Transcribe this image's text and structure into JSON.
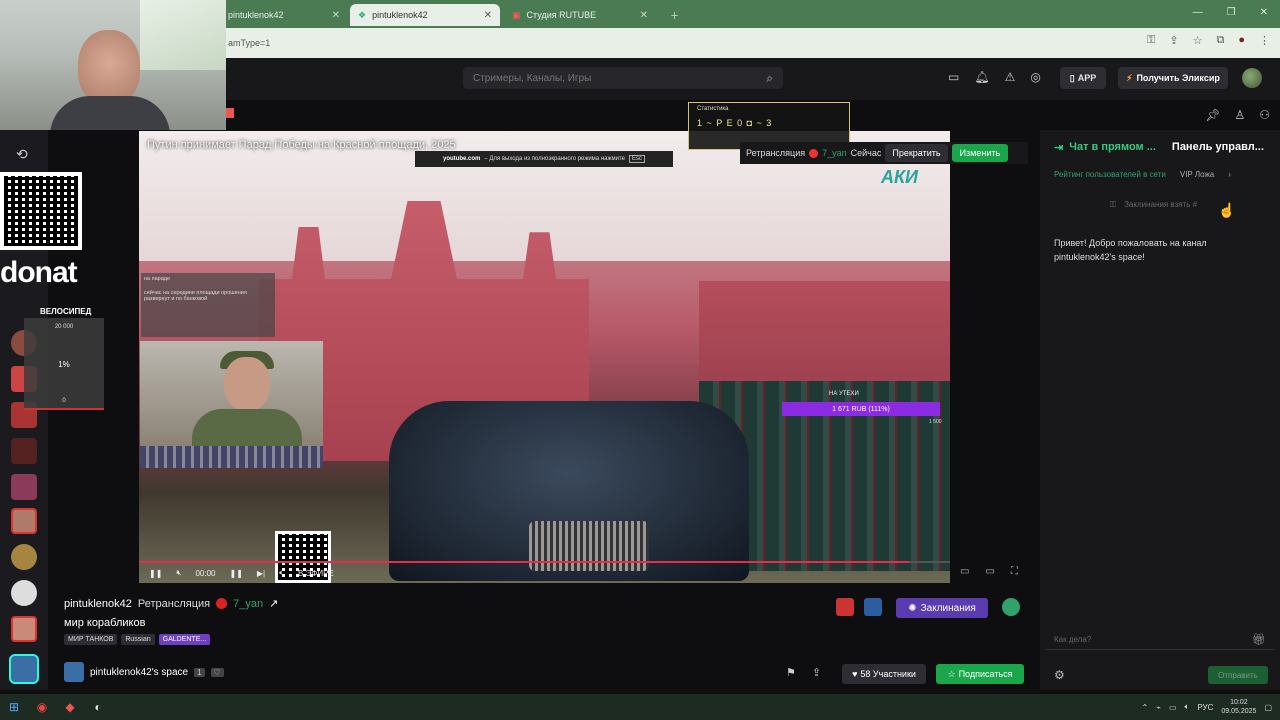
{
  "browser": {
    "tabs": [
      {
        "label": "pintuklenok42"
      },
      {
        "label": "pintuklenok42"
      },
      {
        "label": "Студия RUTUBE"
      }
    ],
    "address": "amType=1"
  },
  "header": {
    "search_placeholder": "Стримеры, Каналы, Игры",
    "app_label": "APP",
    "elixir_label": "Получить Эликсир"
  },
  "left_overlay": {
    "donat_text": "donat",
    "bike_label": "ВЕЛОСИПЕД",
    "goal_top": "20 000",
    "goal_percent": "1%",
    "goal_bottom": "0"
  },
  "video": {
    "title": "Путин принимает Парад Победы на Красной площади, 2025",
    "yt_domain": "youtube.com",
    "yt_notice": "– Для выхода из полноэкранного режима нажмите",
    "yt_key": "Esc",
    "channel_logo": "АКИ",
    "overlay_chat_1": "на параде",
    "overlay_chat_2": "сейчас на середине площади орошения развернут и по банковой",
    "donation_title": "НА УТЕХИ",
    "donation_amount": "1 671 RUB (111%)",
    "donation_goal": "1 500",
    "time": "00:00",
    "live_label": "В ЭФИРЕ"
  },
  "stats_overlay": {
    "title": "Статистика",
    "row": "1 ~ P E 0 ◘ ~ 3"
  },
  "live_bar": {
    "retrans": "Ретрансляция",
    "yt": "7_уan",
    "now": "Сейчас",
    "stop": "Прекратить",
    "change": "Изменить"
  },
  "chat": {
    "tab_live": "Чат в прямом ...",
    "tab_panel": "Панель управл...",
    "rating": "Рейтинг пользователей в сети",
    "vip": "VIP Ложа",
    "spells_hint": "Заклинания взять #",
    "welcome": "Привет! Добро пожаловать на канал pintuklenok42's space!",
    "input_placeholder": "Как дела?",
    "send": "Отправить"
  },
  "stream_info": {
    "streamer": "pintuklenok42",
    "retrans": "Ретрансляция",
    "source": "7_уan",
    "title": "мир корабликов",
    "tags": [
      "МИР ТАНКОВ",
      "Russian",
      "GALDENTE..."
    ],
    "spells_button": "Заклинания",
    "space_name": "pintuklenok42's space",
    "participants": "58 Участники",
    "subscribe": "Подписаться"
  },
  "taskbar": {
    "lang": "РУС",
    "time": "10:02",
    "date": "09.05.2025"
  },
  "colors": {
    "accent_green": "#1aa64a",
    "accent_purple": "#5b3cb0",
    "live_red": "#e62e4a",
    "browser_green": "#4a7b52"
  }
}
